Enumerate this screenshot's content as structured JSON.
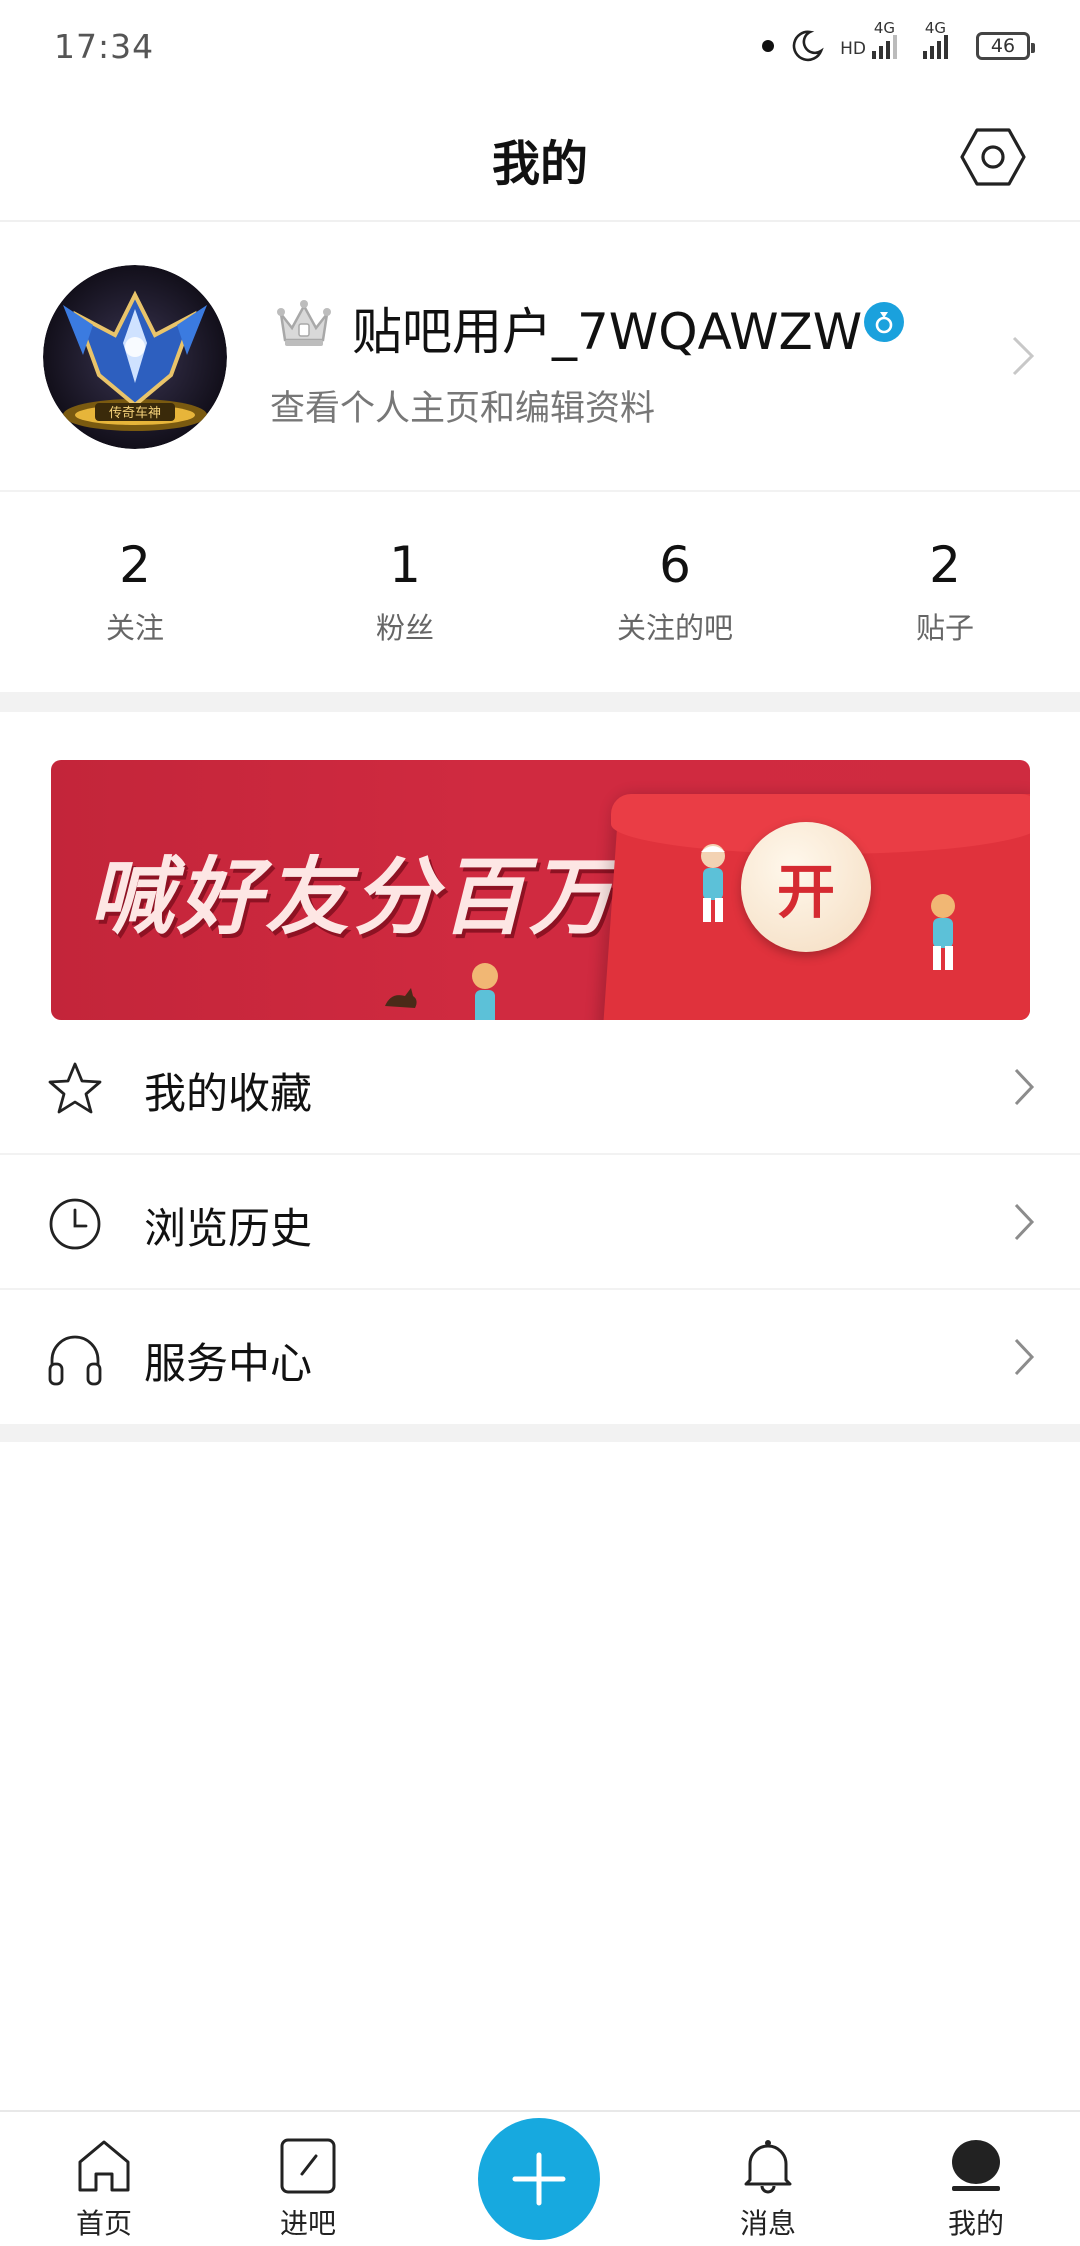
{
  "status_bar": {
    "time": "17:34",
    "sim1_label": "4G",
    "sim2_label": "4G",
    "hd_label": "HD",
    "battery": "46"
  },
  "header": {
    "title": "我的",
    "settings_icon": "settings-hexagon-icon"
  },
  "profile": {
    "username": "贴吧用户_7WQAWZW",
    "subtitle": "查看个人主页和编辑资料",
    "avatar_caption": "传奇车神"
  },
  "stats": [
    {
      "value": "2",
      "label": "关注"
    },
    {
      "value": "1",
      "label": "粉丝"
    },
    {
      "value": "6",
      "label": "关注的吧"
    },
    {
      "value": "2",
      "label": "贴子"
    }
  ],
  "banner": {
    "text": "喊好友分百万",
    "button": "开"
  },
  "menu": [
    {
      "label": "我的收藏",
      "icon": "star-icon"
    },
    {
      "label": "浏览历史",
      "icon": "clock-icon"
    },
    {
      "label": "服务中心",
      "icon": "headphones-icon"
    }
  ],
  "bottom_nav": {
    "home": "首页",
    "enter_bar": "进吧",
    "messages": "消息",
    "mine": "我的"
  },
  "colors": {
    "accent": "#17a9df",
    "banner_red": "#c3253a",
    "verified_badge": "#1aa1dd"
  }
}
